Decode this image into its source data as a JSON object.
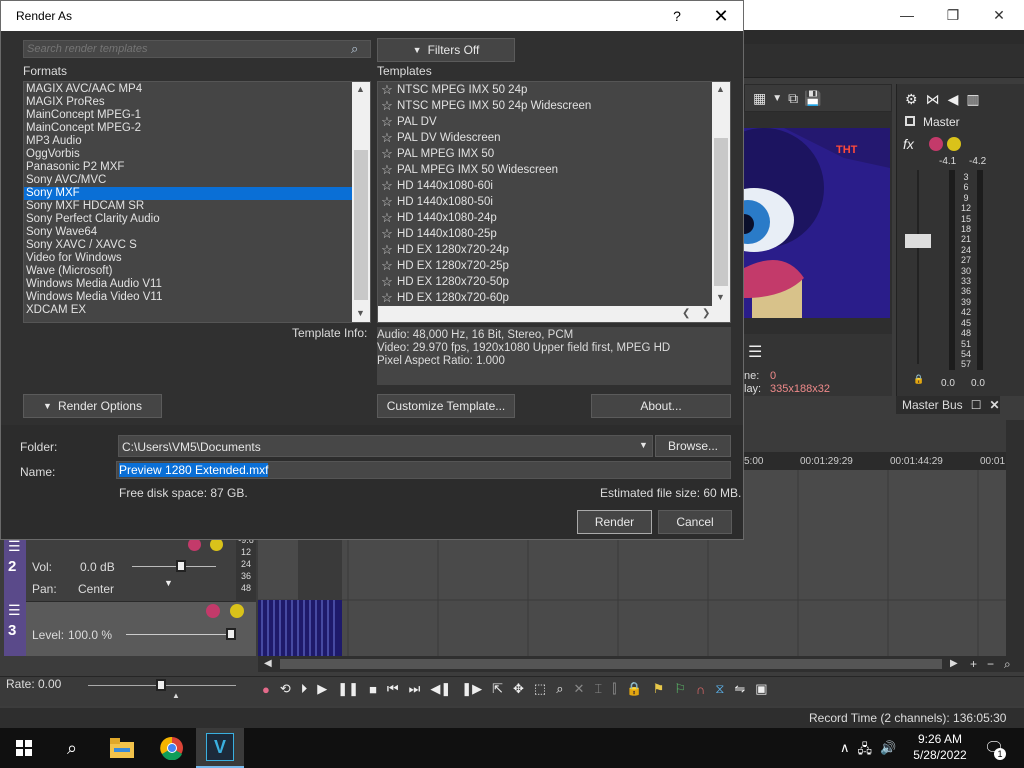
{
  "dialog": {
    "title": "Render As",
    "help_label": "?",
    "search_placeholder": "Search render templates",
    "filters_label": "Filters Off",
    "formats_heading": "Formats",
    "templates_heading": "Templates",
    "formats": [
      "MAGIX AVC/AAC MP4",
      "MAGIX ProRes",
      "MainConcept MPEG-1",
      "MainConcept MPEG-2",
      "MP3 Audio",
      "OggVorbis",
      "Panasonic P2 MXF",
      "Sony AVC/MVC",
      "Sony MXF",
      "Sony MXF HDCAM SR",
      "Sony Perfect Clarity Audio",
      "Sony Wave64",
      "Sony XAVC / XAVC S",
      "Video for Windows",
      "Wave (Microsoft)",
      "Windows Media Audio V11",
      "Windows Media Video V11",
      "XDCAM EX"
    ],
    "selected_format": "Sony MXF",
    "templates": [
      "NTSC MPEG IMX 50 24p",
      "NTSC MPEG IMX 50 24p Widescreen",
      "PAL DV",
      "PAL DV Widescreen",
      "PAL MPEG IMX 50",
      "PAL MPEG IMX 50 Widescreen",
      "HD 1440x1080-60i",
      "HD 1440x1080-50i",
      "HD 1440x1080-24p",
      "HD 1440x1080-25p",
      "HD EX 1280x720-24p",
      "HD EX 1280x720-25p",
      "HD EX 1280x720-50p",
      "HD EX 1280x720-60p"
    ],
    "template_info_label": "Template Info:",
    "template_info": [
      "Audio: 48,000 Hz, 16 Bit, Stereo, PCM",
      "Video: 29.970 fps, 1920x1080 Upper field first, MPEG HD",
      "Pixel Aspect Ratio: 1.000"
    ],
    "render_options_label": "Render Options",
    "customize_label": "Customize Template...",
    "about_label": "About...",
    "folder_label": "Folder:",
    "folder_value": "C:\\Users\\VM5\\Documents",
    "browse_label": "Browse...",
    "name_label": "Name:",
    "name_value": "Preview 1280 Extended.mxf",
    "free_disk": "Free disk space: 87 GB.",
    "estimated_size": "Estimated file size: 60 MB.",
    "render_label": "Render",
    "cancel_label": "Cancel"
  },
  "app": {
    "preview_info": {
      "line1_label": "ne:",
      "line1_value": "0",
      "line2_label": "lay:",
      "line2_value": "335x188x32"
    },
    "preview_logo": "THT",
    "master_label": "Master",
    "master_levels": [
      "-4.1",
      "-4.2"
    ],
    "meter_scale": [
      "3",
      "6",
      "9",
      "12",
      "15",
      "18",
      "21",
      "24",
      "27",
      "30",
      "33",
      "36",
      "39",
      "42",
      "45",
      "48",
      "51",
      "54",
      "57"
    ],
    "master_bottom": [
      "0.0",
      "0.0"
    ],
    "master_bus_label": "Master Bus",
    "ruler": [
      "5:00",
      "00:01:29:29",
      "00:01:44:29",
      "00:01"
    ],
    "track2": {
      "number": "2",
      "vol_label": "Vol:",
      "vol_value": "0.0 dB",
      "pan_label": "Pan:",
      "pan_value": "Center",
      "meter_top": "-9.6",
      "meter": [
        "12",
        "24",
        "36",
        "48"
      ]
    },
    "track3": {
      "number": "3",
      "level_label": "Level:",
      "level_value": "100.0 %"
    },
    "rate_label": "Rate:",
    "rate_value": "0.00",
    "record_time": "Record Time (2 channels): 136:05:30"
  },
  "taskbar": {
    "time": "9:26 AM",
    "date": "5/28/2022",
    "notification_count": "1"
  },
  "colors": {
    "selection": "#0a6fd6",
    "dialog_bg": "#303030",
    "field_bg": "#474747",
    "preview_blue": "#2a1d8a"
  }
}
